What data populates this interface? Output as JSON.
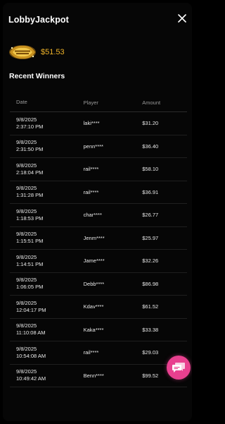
{
  "header": {
    "title": "LobbyJackpot"
  },
  "jackpot": {
    "logo_icon": "jackpot-logo-icon",
    "logo_text": "LOBBY JACKPOT",
    "amount": "$51.53",
    "amount_color": "#f0b429"
  },
  "recent": {
    "title": "Recent Winners",
    "columns": {
      "date": "Date",
      "player": "Player",
      "amount": "Amount"
    },
    "rows": [
      {
        "date": "9/8/2025",
        "time": "2:37:10 PM",
        "player": "laki****",
        "amount": "$31.20"
      },
      {
        "date": "9/8/2025",
        "time": "2:31:50 PM",
        "player": "penn****",
        "amount": "$36.40"
      },
      {
        "date": "9/8/2025",
        "time": "2:18:04 PM",
        "player": "rail****",
        "amount": "$58.10"
      },
      {
        "date": "9/8/2025",
        "time": "1:31:28 PM",
        "player": "rail****",
        "amount": "$36.91"
      },
      {
        "date": "9/8/2025",
        "time": "1:18:53 PM",
        "player": "char****",
        "amount": "$26.77"
      },
      {
        "date": "9/8/2025",
        "time": "1:15:51 PM",
        "player": "Jenm****",
        "amount": "$25.97"
      },
      {
        "date": "9/8/2025",
        "time": "1:14:51 PM",
        "player": "Jame****",
        "amount": "$32.26"
      },
      {
        "date": "9/8/2025",
        "time": "1:06:05 PM",
        "player": "Debb****",
        "amount": "$86.98"
      },
      {
        "date": "9/8/2025",
        "time": "12:04:17 PM",
        "player": "Kdav****",
        "amount": "$61.52"
      },
      {
        "date": "9/8/2025",
        "time": "11:10:08 AM",
        "player": "Kaka****",
        "amount": "$33.38"
      },
      {
        "date": "9/8/2025",
        "time": "10:54:08 AM",
        "player": "rail****",
        "amount": "$29.03"
      },
      {
        "date": "9/8/2025",
        "time": "10:49:42 AM",
        "player": "Benn****",
        "amount": "$99.52"
      }
    ]
  },
  "chat": {
    "icon": "chat-bubbles-icon",
    "color": "#e8408f"
  }
}
